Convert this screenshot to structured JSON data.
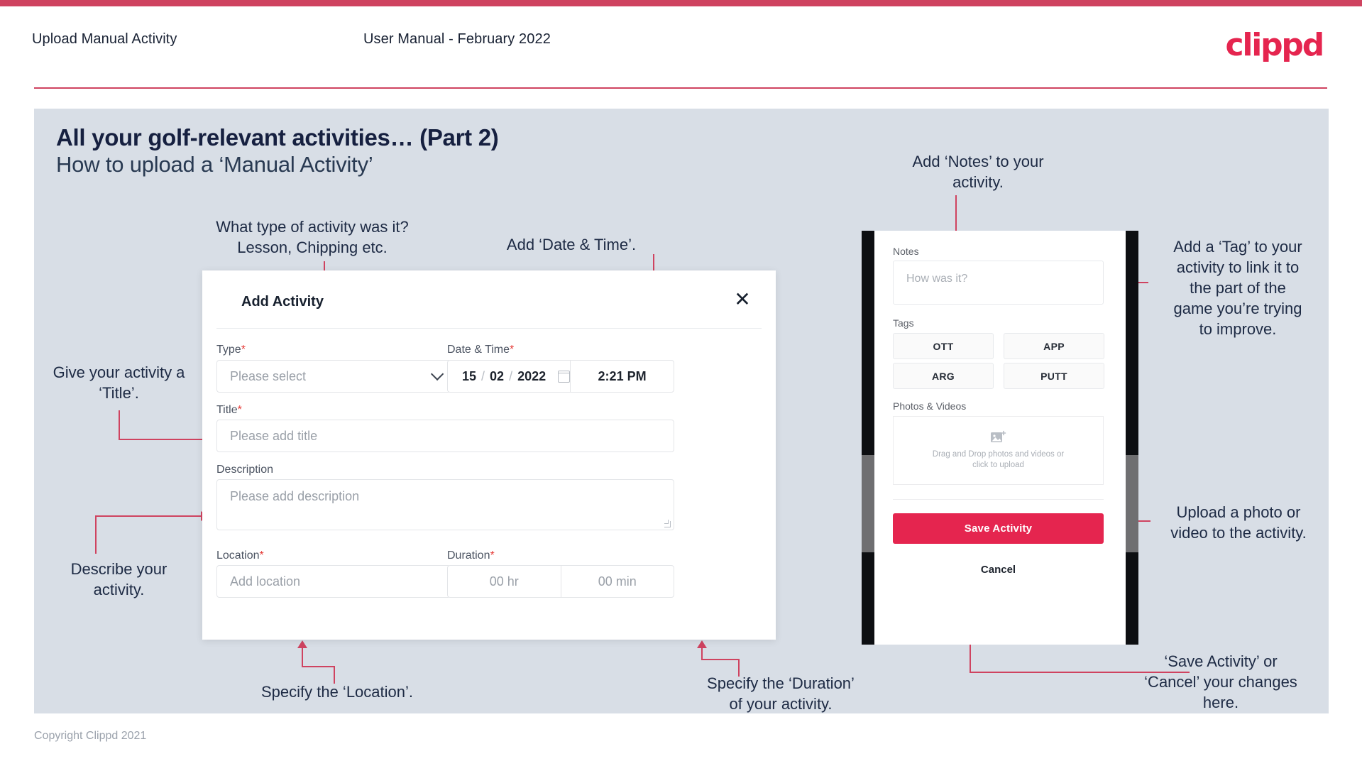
{
  "header": {
    "title": "Upload Manual Activity",
    "subtitle": "User Manual - February 2022",
    "logo": "clippd"
  },
  "slide": {
    "heading": "All your golf-relevant activities… (Part 2)",
    "subheading": "How to upload a ‘Manual Activity’"
  },
  "footer": {
    "copyright": "Copyright Clippd 2021"
  },
  "dialog": {
    "title": "Add Activity",
    "close_icon": "close-icon",
    "type": {
      "label": "Type",
      "required": "*",
      "placeholder": "Please select"
    },
    "datetime": {
      "label": "Date & Time",
      "required": "*",
      "day": "15",
      "month": "02",
      "year": "2022",
      "sep1": "/",
      "sep2": "/",
      "time": "2:21 PM"
    },
    "title_field": {
      "label": "Title",
      "required": "*",
      "placeholder": "Please add title"
    },
    "description": {
      "label": "Description",
      "placeholder": "Please add description"
    },
    "location": {
      "label": "Location",
      "required": "*",
      "placeholder": "Add location"
    },
    "duration": {
      "label": "Duration",
      "required": "*",
      "hours": "00 hr",
      "minutes": "00 min"
    }
  },
  "phone": {
    "notes": {
      "label": "Notes",
      "placeholder": "How was it?"
    },
    "tags": {
      "label": "Tags",
      "items": [
        "OTT",
        "APP",
        "ARG",
        "PUTT"
      ]
    },
    "photos": {
      "label": "Photos & Videos",
      "drop_line1": "Drag and Drop photos and videos or",
      "drop_line2": "click to upload"
    },
    "save_label": "Save Activity",
    "cancel_label": "Cancel"
  },
  "annotations": {
    "type": "What type of activity was it?\nLesson, Chipping etc.",
    "datetime": "Add ‘Date & Time’.",
    "notes": "Add ‘Notes’ to your\nactivity.",
    "tag": "Add a ‘Tag’ to your\nactivity to link it to\nthe part of the\ngame you’re trying\nto improve.",
    "title": "Give your activity a\n‘Title’.",
    "description": "Describe your\nactivity.",
    "location": "Specify the ‘Location’.",
    "duration": "Specify the ‘Duration’\nof your activity.",
    "upload": "Upload a photo or\nvideo to the activity.",
    "save": "‘Save Activity’ or\n‘Cancel’ your changes\nhere."
  },
  "colors": {
    "accent": "#e5254f",
    "bar": "#cf4360",
    "slide_bg": "#d8dee6",
    "text_dark": "#162040"
  }
}
